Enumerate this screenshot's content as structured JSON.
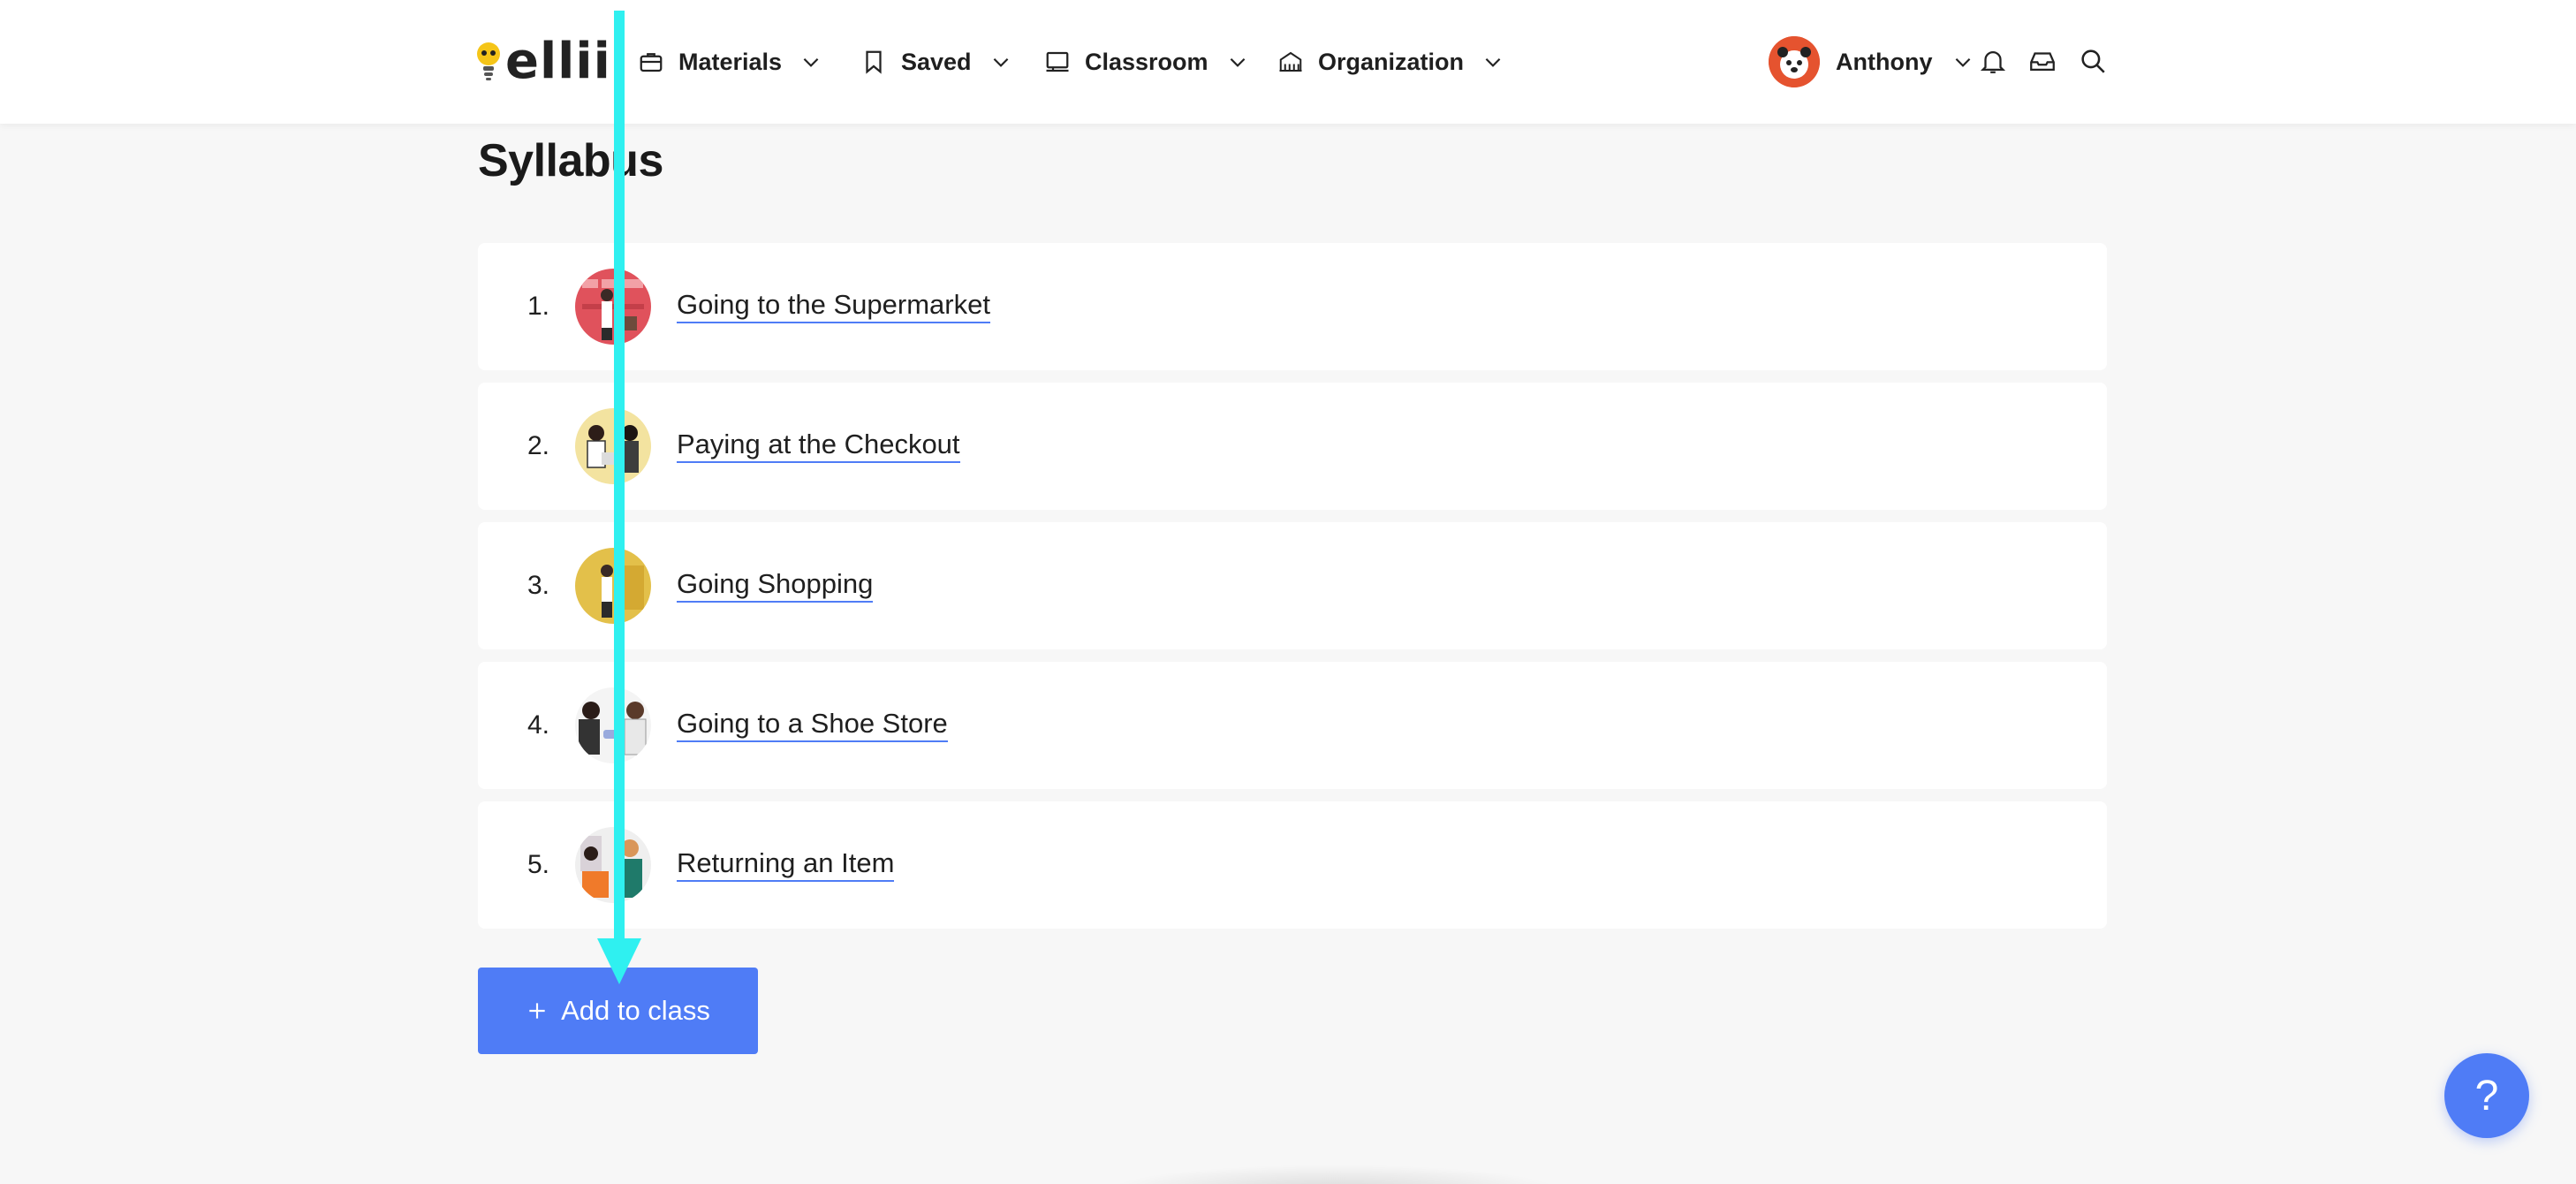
{
  "nav": {
    "logo_text": "ellii",
    "items": [
      {
        "label": "Materials",
        "icon": "briefcase-icon"
      },
      {
        "label": "Saved",
        "icon": "bookmark-icon"
      },
      {
        "label": "Classroom",
        "icon": "chalkboard-icon"
      },
      {
        "label": "Organization",
        "icon": "building-icon"
      }
    ],
    "user_name": "Anthony",
    "right_icons": [
      "bell-icon",
      "inbox-icon",
      "search-icon"
    ]
  },
  "page": {
    "title": "Syllabus",
    "items": [
      {
        "number": "1.",
        "label": "Going to the Supermarket"
      },
      {
        "number": "2.",
        "label": "Paying at the Checkout"
      },
      {
        "number": "3.",
        "label": "Going Shopping"
      },
      {
        "number": "4.",
        "label": "Going to a Shoe Store"
      },
      {
        "number": "5.",
        "label": "Returning an Item"
      }
    ],
    "add_button_label": "Add to class",
    "help_label": "?"
  },
  "colors": {
    "accent": "#4f7cf6",
    "background": "#f7f7f7",
    "annotation_arrow": "#2ff0f0"
  }
}
